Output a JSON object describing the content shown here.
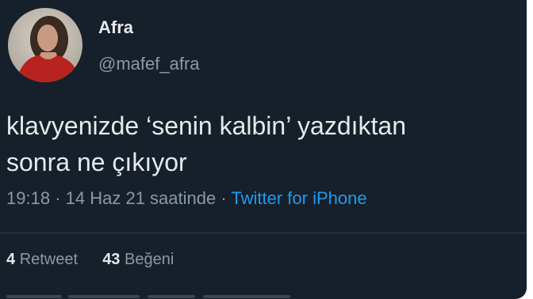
{
  "user": {
    "display_name": "Afra",
    "handle": "@mafef_afra",
    "avatar_icon": "profile-photo"
  },
  "tweet": {
    "text_line1": "klavyenizde ‘senin kalbin’ yazdıktan",
    "text_line2": "sonra ne çıkıyor",
    "time": "19:18",
    "separator": "·",
    "date": "14 Haz 21 saatinde",
    "source": "Twitter for iPhone"
  },
  "stats": {
    "retweet_count": "4",
    "retweet_label": "Retweet",
    "like_count": "43",
    "like_label": "Beğeni"
  },
  "colors": {
    "background": "#15202b",
    "text": "#e7e9ea",
    "muted": "#8b98a5",
    "link": "#1d9bf0"
  }
}
